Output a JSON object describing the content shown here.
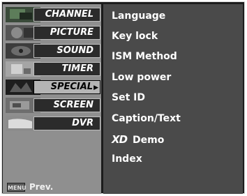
{
  "left_menu": {
    "items": [
      {
        "label": "CHANNEL",
        "thumb_color": "#3a5a3a"
      },
      {
        "label": "PICTURE",
        "thumb_color": "#6a6a6a"
      },
      {
        "label": "SOUND",
        "thumb_color": "#4a4a4a"
      },
      {
        "label": "TIMER",
        "thumb_color": "#9a9a9a"
      },
      {
        "label": "SPECIAL",
        "thumb_color": "#2a2a2a",
        "selected": true
      },
      {
        "label": "SCREEN",
        "thumb_color": "#7a7a7a"
      },
      {
        "label": "DVR",
        "thumb_color": "#b0b0b0"
      }
    ],
    "selected_arrow": "▶"
  },
  "footer": {
    "menu_badge": "MENU",
    "prev_label": "Prev."
  },
  "submenu": {
    "items": [
      {
        "label": "Language"
      },
      {
        "label": "Key lock"
      },
      {
        "label": "ISM Method"
      },
      {
        "label": "Low power"
      },
      {
        "label": "Set ID"
      },
      {
        "label": "Caption/Text"
      },
      {
        "label": "Demo",
        "logo": "XD"
      },
      {
        "label": "Index"
      }
    ]
  },
  "colors": {
    "left_bg": "#8f8f8f",
    "right_bg": "#4a4a4a",
    "tab_bg": "#2b2b2b",
    "tab_selected_bg": "#b5b5b5"
  }
}
